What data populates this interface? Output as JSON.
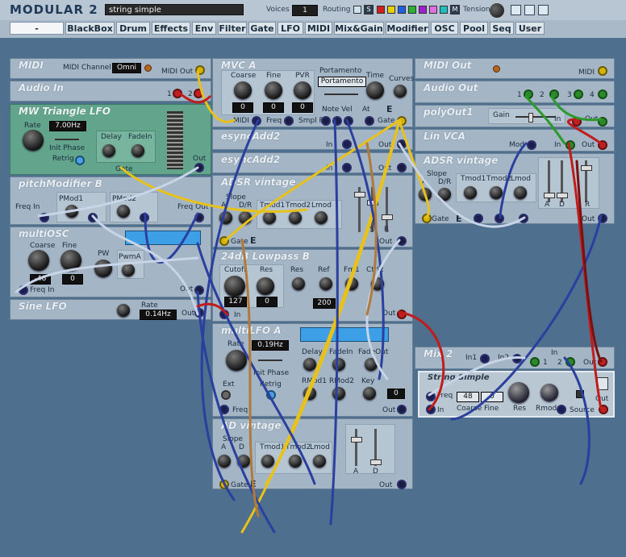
{
  "app": {
    "title": "MODULAR 2",
    "patch_name": "string simple"
  },
  "toolbar": {
    "voices_label": "Voices",
    "voices_value": "1",
    "routing_label": "Routing",
    "routing_s": "S",
    "routing_m": "M",
    "tension_label": "Tension"
  },
  "categories": [
    "-=Flexor=-",
    "BlackBox",
    "Drum",
    "Effects",
    "Env",
    "Filter",
    "Gate",
    "LFO",
    "MIDI",
    "Mix&Gain",
    "Modifier",
    "OSC",
    "Pool",
    "Seq",
    "User"
  ],
  "colors": {
    "background": "#4e6f8d",
    "module": "#a4b5c5",
    "lfo_module": "#62a58c",
    "cable_yellow": "#e8c21a",
    "cable_blue": "#2a3f9e",
    "cable_red": "#c01c1c",
    "cable_green": "#2b9a2b",
    "cable_white": "#c8d4e8",
    "cable_brown": "#b07a3a"
  },
  "modules": {
    "midi": {
      "title": "MIDI",
      "channel_label": "MIDI Channel",
      "channel_value": "Omni",
      "out_label": "MIDI Out"
    },
    "audio_in": {
      "title": "Audio In",
      "j1": "1",
      "j2": "2"
    },
    "mw_lfo": {
      "title": "MW Triangle LFO",
      "rate_label": "Rate",
      "rate_value": "7.00Hz",
      "init_phase": "Init Phase",
      "retrig": "Retrig",
      "delay": "Delay",
      "fadein": "FadeIn",
      "out": "Out",
      "gate": "Gate"
    },
    "pitch_mod": {
      "title": "pitchModifier B",
      "freq_in": "Freq In",
      "pmod1": "PMod1",
      "pmod2": "PMod2",
      "freq_out": "Freq Out"
    },
    "multiosc": {
      "title": "multiOSC",
      "coarse": "Coarse",
      "fine": "Fine",
      "coarse_value": "-48",
      "fine_value": "0",
      "pw": "PW",
      "pwma": "PwmA",
      "freq_in": "Freq In",
      "out": "Out"
    },
    "sine_lfo": {
      "title": "Sine LFO",
      "rate": "Rate",
      "rate_value": "0.14Hz",
      "out": "Out"
    },
    "mvc": {
      "title": "MVC A",
      "coarse": "Coarse",
      "fine": "Fine",
      "pvr": "PVR",
      "coarse_value": "0",
      "fine_value": "0",
      "pvr_value": "0",
      "portamento_label": "Portamento",
      "portamento_value": "Portamento",
      "time": "Time",
      "curves": "Curves",
      "midi": "MIDI",
      "freq": "Freq",
      "smpl_f": "Smpl F",
      "note_vel": "Note Vel",
      "at": "At",
      "e": "E",
      "gate": "Gate"
    },
    "esync1": {
      "title": "esyncAdd2",
      "in": "In",
      "out": "Out"
    },
    "esync2": {
      "title": "esyncAdd2",
      "in": "In",
      "out": "Out"
    },
    "adsr1": {
      "title": "ADSR vintage",
      "slope": "Slope",
      "a": "A",
      "dr": "D/R",
      "tmod1": "Tmod1",
      "tmod2": "Tmod2",
      "lmod": "Lmod",
      "s": "S",
      "r": "R",
      "gate": "Gate",
      "e": "E",
      "out": "Out"
    },
    "lowpass": {
      "title": "24dB Lowpass B",
      "cutoff": "Cutoff",
      "cutoff_value": "127",
      "res": "Res",
      "res_value": "0",
      "res2": "Res",
      "ref": "Ref",
      "ref_value": "200",
      "fm1": "Fm1",
      "ctrl2": "Ctrl2",
      "in": "In",
      "out": "Out"
    },
    "multilfo": {
      "title": "multiLFO A",
      "rate": "Rate",
      "rate_value": "0.19Hz",
      "init_phase": "Init Phase",
      "retrig": "Retrig",
      "delay": "Delay",
      "fadein": "FadeIn",
      "fadeout": "FadeOut",
      "ext": "Ext",
      "rmod1": "RMod1",
      "rmod2": "RMod2",
      "key": "Key",
      "key_value": "0",
      "freq": "Freq",
      "out": "Out"
    },
    "ad": {
      "title": "AD vintage",
      "slope": "Slope",
      "a": "A",
      "d": "D",
      "tmod1": "Tmod1",
      "tmod2": "Tmod2",
      "lmod": "Lmod",
      "gate": "Gate",
      "e": "E",
      "out": "Out"
    },
    "midi_out": {
      "title": "MIDI Out",
      "midi": "MIDI"
    },
    "audio_out": {
      "title": "Audio Out",
      "j1": "1",
      "j2": "2",
      "j3": "3",
      "j4": "4"
    },
    "polyout": {
      "title": "polyOut1",
      "gain": "Gain",
      "in": "In",
      "out": "Out"
    },
    "linvca": {
      "title": "Lin VCA",
      "mod": "Mod",
      "in": "In",
      "out": "Out"
    },
    "adsr2": {
      "title": "ADSR vintage",
      "slope": "Slope",
      "a": "A",
      "dr": "D/R",
      "tmod1": "Tmod1",
      "tmod2": "Tmod2",
      "lmod": "Lmod",
      "ad": "A",
      "d": "D",
      "r": "R",
      "gate": "Gate",
      "e": "E",
      "out": "Out"
    },
    "mix": {
      "title": "Mix 2",
      "in1": "In1",
      "in2": "In2",
      "in": "In",
      "j1": "1",
      "j2": "2",
      "out": "Out"
    },
    "string": {
      "title": "String Simple",
      "freq": "Freq",
      "in": "In",
      "coarse": "Coarse",
      "coarse_value": "48",
      "fine": "Fine",
      "fine_value": "0",
      "res": "Res",
      "rmod": "Rmod",
      "source": "Source",
      "out": "Out"
    }
  }
}
